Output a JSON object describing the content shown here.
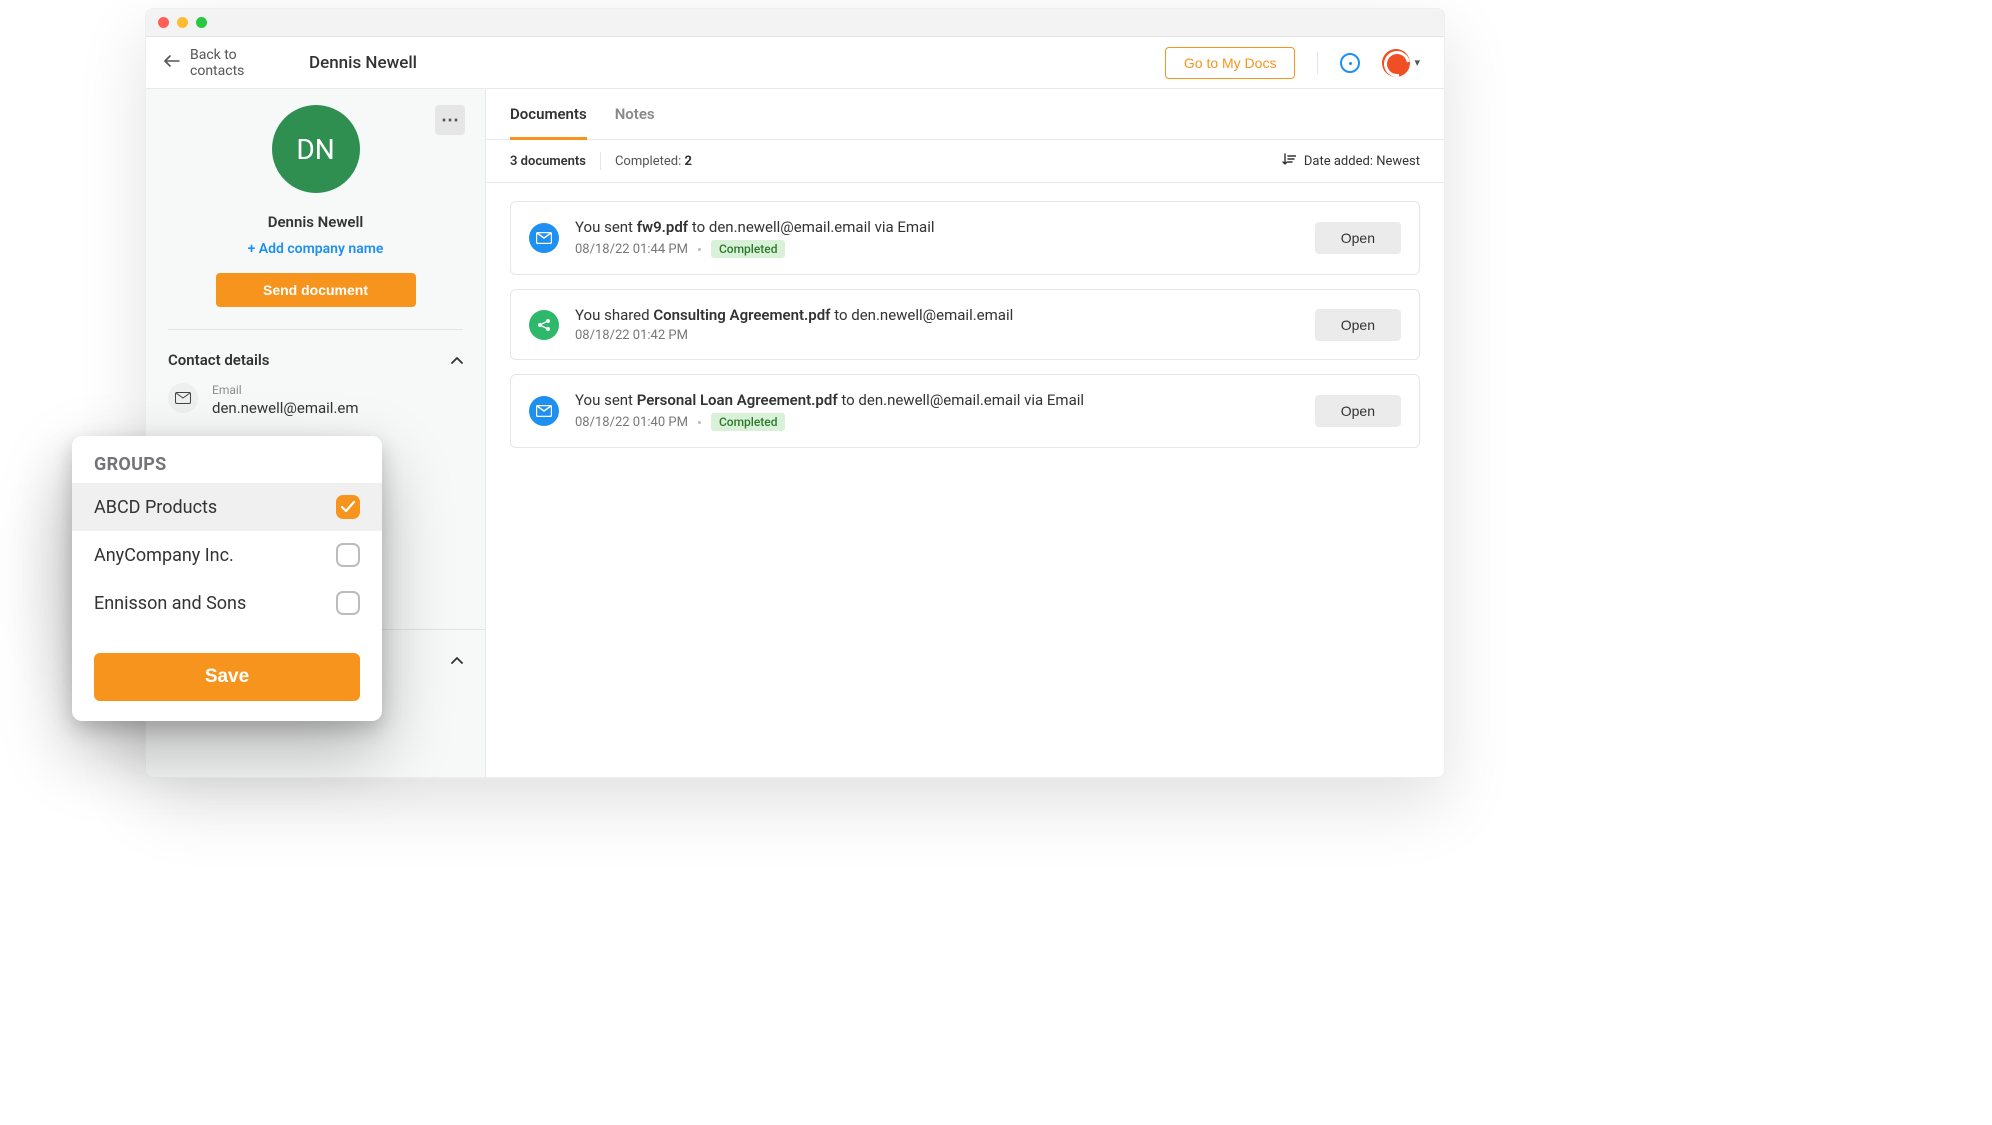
{
  "header": {
    "back_label": "Back to contacts",
    "title": "Dennis Newell",
    "go_to_docs": "Go to My Docs"
  },
  "sidebar": {
    "avatar_initials": "DN",
    "name": "Dennis Newell",
    "add_company_label": "+ Add company name",
    "send_document_label": "Send document",
    "contact_details_label": "Contact details",
    "email_label": "Email",
    "email_value": "den.newell@email.em"
  },
  "tabs": {
    "documents": "Documents",
    "notes": "Notes"
  },
  "filters": {
    "count_text": "3 documents",
    "completed_prefix": "Completed: ",
    "completed_value": "2",
    "sort_label": "Date added: Newest"
  },
  "documents": [
    {
      "prefix": "You sent ",
      "bold": "fw9.pdf",
      "mid": " to ",
      "rest": "den.newell@email.email via Email",
      "time": "08/18/22 01:44 PM",
      "status": "Completed",
      "icon": "mail",
      "open": "Open"
    },
    {
      "prefix": "You shared ",
      "bold": "Consulting Agreement.pdf",
      "mid": " to ",
      "rest": "den.newell@email.email",
      "time": "08/18/22 01:42 PM",
      "status": "",
      "icon": "share",
      "open": "Open"
    },
    {
      "prefix": "You sent ",
      "bold": "Personal Loan Agreement.pdf",
      "mid": " to ",
      "rest": "den.newell@email.email via Email",
      "time": "08/18/22 01:40 PM",
      "status": "Completed",
      "icon": "mail",
      "open": "Open"
    }
  ],
  "groups": {
    "label": "GROUPS",
    "items": [
      {
        "name": "ABCD Products",
        "checked": true
      },
      {
        "name": "AnyCompany Inc.",
        "checked": false
      },
      {
        "name": "Ennisson and Sons",
        "checked": false
      }
    ],
    "save_label": "Save"
  }
}
